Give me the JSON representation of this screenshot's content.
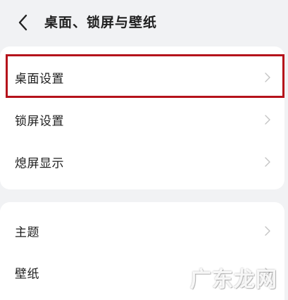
{
  "header": {
    "title": "桌面、锁屏与壁纸",
    "back_icon": "chevron-left-icon"
  },
  "settings_group_1": {
    "items": [
      {
        "label": "桌面设置",
        "icon": "chevron-right-icon",
        "highlighted": true
      },
      {
        "label": "锁屏设置",
        "icon": "chevron-right-icon"
      },
      {
        "label": "熄屏显示",
        "icon": "chevron-right-icon"
      }
    ]
  },
  "settings_group_2": {
    "items": [
      {
        "label": "主题",
        "icon": "chevron-right-icon"
      },
      {
        "label": "壁纸",
        "icon": "chevron-right-icon"
      }
    ]
  },
  "watermark": {
    "text": "广东龙网"
  },
  "colors": {
    "background": "#f1f2f4",
    "card": "#ffffff",
    "highlight_border": "#b5121b",
    "text": "#1e1e1e",
    "chevron": "#c4c4c4"
  }
}
